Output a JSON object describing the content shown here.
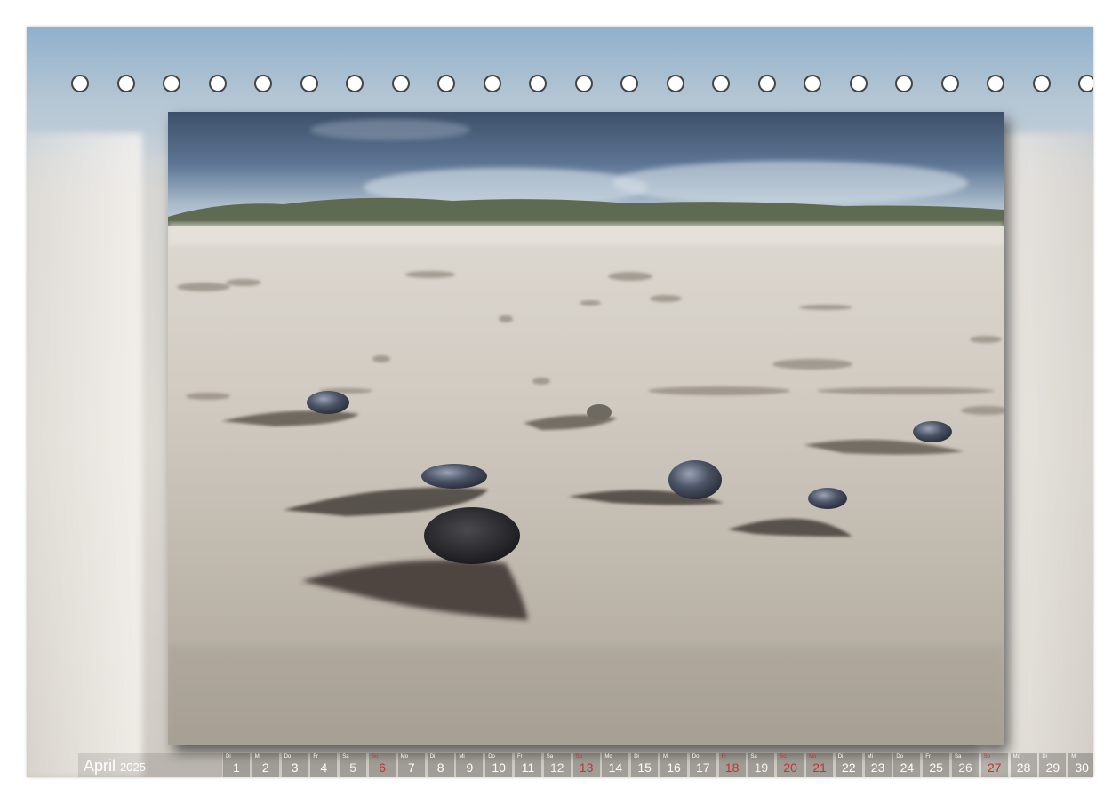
{
  "calendar": {
    "month": "April",
    "year": "2025",
    "days": [
      {
        "wd": "Di",
        "n": "1",
        "type": "normal"
      },
      {
        "wd": "Mi",
        "n": "2",
        "type": "normal"
      },
      {
        "wd": "Do",
        "n": "3",
        "type": "normal"
      },
      {
        "wd": "Fr",
        "n": "4",
        "type": "normal"
      },
      {
        "wd": "Sa",
        "n": "5",
        "type": "sat"
      },
      {
        "wd": "So",
        "n": "6",
        "type": "sun"
      },
      {
        "wd": "Mo",
        "n": "7",
        "type": "normal"
      },
      {
        "wd": "Di",
        "n": "8",
        "type": "normal"
      },
      {
        "wd": "Mi",
        "n": "9",
        "type": "normal"
      },
      {
        "wd": "Do",
        "n": "10",
        "type": "normal"
      },
      {
        "wd": "Fr",
        "n": "11",
        "type": "normal"
      },
      {
        "wd": "Sa",
        "n": "12",
        "type": "sat"
      },
      {
        "wd": "So",
        "n": "13",
        "type": "sun"
      },
      {
        "wd": "Mo",
        "n": "14",
        "type": "normal"
      },
      {
        "wd": "Di",
        "n": "15",
        "type": "normal"
      },
      {
        "wd": "Mi",
        "n": "16",
        "type": "normal"
      },
      {
        "wd": "Do",
        "n": "17",
        "type": "normal"
      },
      {
        "wd": "Fr",
        "n": "18",
        "type": "sun"
      },
      {
        "wd": "Sa",
        "n": "19",
        "type": "sat"
      },
      {
        "wd": "So",
        "n": "20",
        "type": "sun"
      },
      {
        "wd": "Mo",
        "n": "21",
        "type": "sun"
      },
      {
        "wd": "Di",
        "n": "22",
        "type": "normal"
      },
      {
        "wd": "Mi",
        "n": "23",
        "type": "normal"
      },
      {
        "wd": "Do",
        "n": "24",
        "type": "normal"
      },
      {
        "wd": "Fr",
        "n": "25",
        "type": "normal"
      },
      {
        "wd": "Sa",
        "n": "26",
        "type": "sat"
      },
      {
        "wd": "So",
        "n": "27",
        "type": "sun"
      },
      {
        "wd": "Mo",
        "n": "28",
        "type": "normal"
      },
      {
        "wd": "Di",
        "n": "29",
        "type": "normal"
      },
      {
        "wd": "Mi",
        "n": "30",
        "type": "normal"
      }
    ]
  },
  "binding": {
    "hole_count": 23
  },
  "colors": {
    "holiday": "#c8322c",
    "sky": "#5d7594",
    "sand": "#cdc7bd"
  }
}
